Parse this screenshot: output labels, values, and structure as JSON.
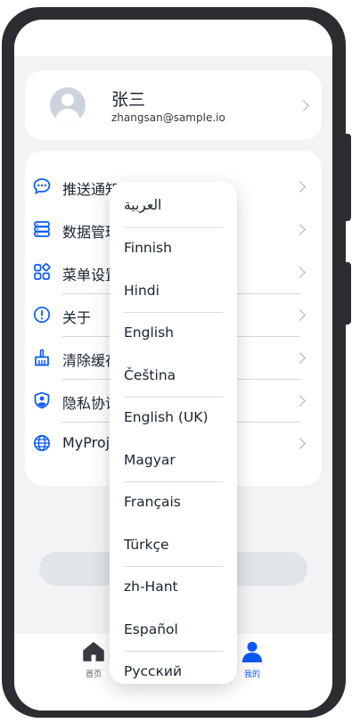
{
  "profile": {
    "name": "张三",
    "email": "zhangsan@sample.io"
  },
  "menu": [
    {
      "label": "推送通知",
      "icon": "chat-bubble-icon"
    },
    {
      "label": "数据管理",
      "icon": "database-icon"
    },
    {
      "label": "菜单设置",
      "icon": "grid-menu-icon"
    },
    {
      "label": "关于",
      "icon": "info-icon"
    },
    {
      "label": "清除缓存",
      "icon": "broom-icon"
    },
    {
      "label": "隐私协议",
      "icon": "shield-user-icon"
    },
    {
      "label": "MyProje",
      "icon": "globe-icon"
    }
  ],
  "language_options": [
    "العربية",
    "Finnish",
    "Hindi",
    "English",
    "Čeština",
    "English (UK)",
    "Magyar",
    "Français",
    "Türkçe",
    "zh-Hant",
    "Español",
    "Русский"
  ],
  "tabs": [
    {
      "label": "首页",
      "icon": "home-icon",
      "active": false
    },
    {
      "label": "我的",
      "icon": "person-icon",
      "active": true
    }
  ],
  "colors": {
    "accent": "#0a59f7",
    "text": "#182431",
    "background": "#f1f3f5"
  }
}
